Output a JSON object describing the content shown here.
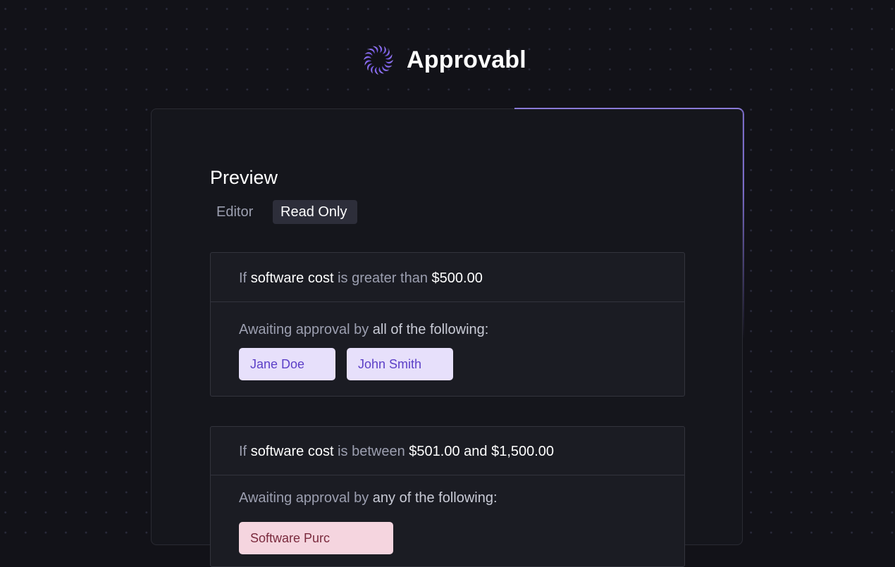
{
  "brand": {
    "name": "Approvabl",
    "logo_icon": "spiral-petals-logo-icon",
    "accent": "#8b6cf0"
  },
  "preview": {
    "title": "Preview",
    "tabs": [
      {
        "label": "Editor",
        "active": false
      },
      {
        "label": "Read Only",
        "active": true
      }
    ]
  },
  "rules": [
    {
      "condition": {
        "prefix": "If",
        "field": "software cost",
        "verb": "is",
        "operator": "greater than",
        "value": "$500.00"
      },
      "approval": {
        "prefix": "Awaiting approval by",
        "mode": "all",
        "suffix": "of the following:"
      },
      "approvers": [
        "Jane Doe",
        "John Smith"
      ]
    },
    {
      "condition": {
        "prefix": "If",
        "field": "software cost",
        "verb": "is",
        "operator": "between",
        "value_low": "$501.00",
        "joiner": "and",
        "value_high": "$1,500.00"
      },
      "approval": {
        "prefix": "Awaiting approval by",
        "mode": "any",
        "suffix": "of the following:"
      },
      "approvers": [
        "Software Purc"
      ]
    }
  ],
  "colors": {
    "background": "#121218",
    "card": "#15161c",
    "rule_panel": "#1b1c23",
    "chip_purple_bg": "#e7e0fb",
    "chip_purple_text": "#5b3fc7",
    "chip_pink_bg": "#f5d5df"
  }
}
